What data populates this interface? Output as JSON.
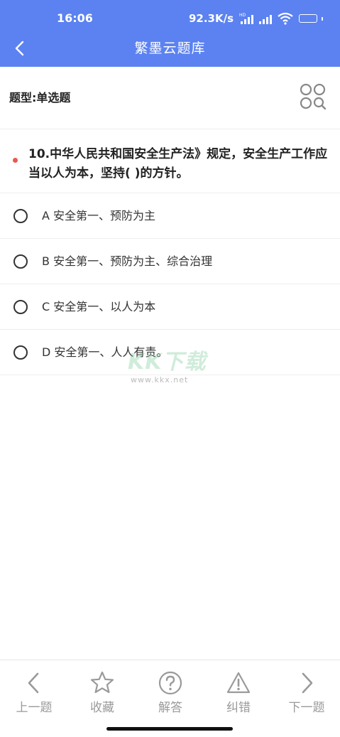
{
  "status": {
    "time": "16:06",
    "net_speed": "92.3K/s",
    "battery": "100",
    "battery_level": 1.0
  },
  "header": {
    "title": "繁墨云题库"
  },
  "question_type": {
    "label": "题型:单选题"
  },
  "question": {
    "text": "10.中华人民共和国安全生产法》规定，安全生产工作应当以人为本，坚持( )的方针。"
  },
  "options": [
    {
      "text": "A 安全第一、预防为主"
    },
    {
      "text": "B 安全第一、预防为主、综合治理"
    },
    {
      "text": "C 安全第一、以人为本"
    },
    {
      "text": "D 安全第一、人人有责。"
    }
  ],
  "watermark": {
    "main": "KK下载",
    "sub": "www.kkx.net"
  },
  "bottom_nav": {
    "prev": "上一题",
    "favorite": "收藏",
    "answer": "解答",
    "report": "纠错",
    "next": "下一题"
  },
  "colors": {
    "header_bg": "#5b82f0",
    "dot": "#e85a4f",
    "nav_label": "#9a9a9a"
  },
  "icons": {
    "back": "chevron-left-icon",
    "grid": "grid-search-icon",
    "prev": "chevron-left-icon",
    "favorite": "star-icon",
    "answer": "question-circle-icon",
    "report": "warning-triangle-icon",
    "next": "chevron-right-icon"
  }
}
